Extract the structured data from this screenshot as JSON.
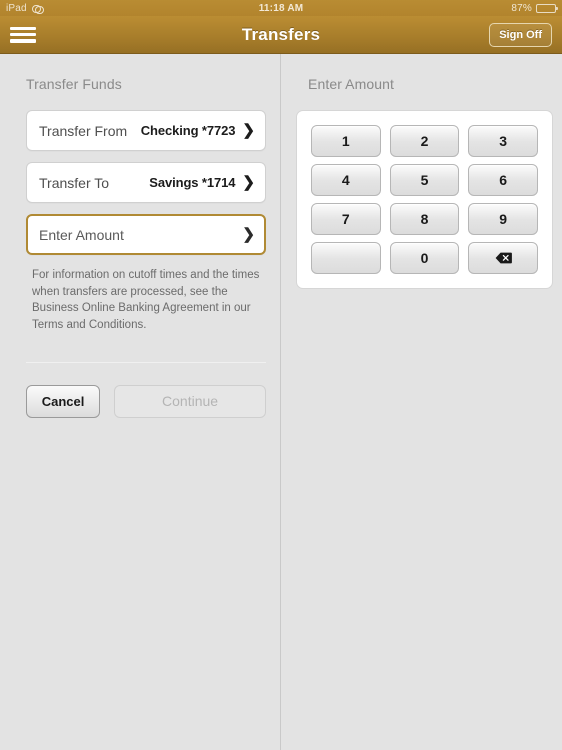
{
  "statusbar": {
    "device": "iPad",
    "link_icon": "chain-link-icon",
    "time": "11:18 AM",
    "battery_percent": "87%",
    "battery_level": 87
  },
  "navbar": {
    "menu_icon": "hamburger-menu-icon",
    "title": "Transfers",
    "signoff_label": "Sign Off"
  },
  "left_pane": {
    "section_title": "Transfer Funds",
    "fields": [
      {
        "label": "Transfer From",
        "value": "Checking *7723",
        "active": false
      },
      {
        "label": "Transfer To",
        "value": "Savings *1714",
        "active": false
      },
      {
        "label": "Enter Amount",
        "value": "",
        "active": true
      }
    ],
    "disclaimer": "For information on cutoff times and the times when transfers are processed, see the Business Online Banking Agreement in our Terms and Conditions.",
    "cancel_label": "Cancel",
    "continue_label": "Continue",
    "continue_enabled": false
  },
  "right_pane": {
    "section_title": "Enter Amount",
    "keypad": [
      {
        "label": "1",
        "name": "key-1"
      },
      {
        "label": "2",
        "name": "key-2"
      },
      {
        "label": "3",
        "name": "key-3"
      },
      {
        "label": "4",
        "name": "key-4"
      },
      {
        "label": "5",
        "name": "key-5"
      },
      {
        "label": "6",
        "name": "key-6"
      },
      {
        "label": "7",
        "name": "key-7"
      },
      {
        "label": "8",
        "name": "key-8"
      },
      {
        "label": "9",
        "name": "key-9"
      },
      {
        "label": "",
        "name": "key-blank"
      },
      {
        "label": "0",
        "name": "key-0"
      },
      {
        "label": "",
        "name": "key-backspace"
      }
    ]
  },
  "colors": {
    "accent_gold": "#b08a34",
    "navbar_gold": "#a87e2b",
    "page_bg": "#e3e3e3",
    "field_bg": "#ffffff"
  }
}
